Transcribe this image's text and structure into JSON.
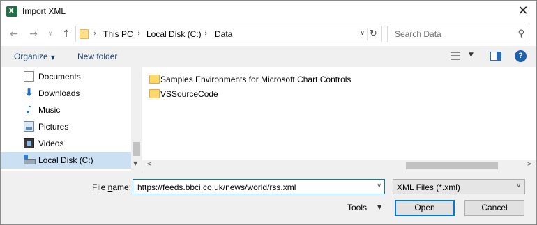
{
  "window": {
    "title": "Import XML",
    "close_glyph": "✕"
  },
  "address_bar": {
    "crumbs": [
      "This PC",
      "Local Disk (C:)",
      "Data"
    ],
    "separator": "›",
    "dropdown_glyph": "∨",
    "refresh_glyph": "↻"
  },
  "search": {
    "placeholder": "Search Data",
    "icon_glyph": "⚲"
  },
  "nav_buttons": {
    "back_glyph": "←",
    "forward_glyph": "→",
    "recent_glyph": "∨",
    "up_glyph": "↑"
  },
  "toolbar": {
    "organize_label": "Organize",
    "organize_caret": "▼",
    "new_folder_label": "New folder",
    "view_caret": "▼",
    "help_glyph": "?"
  },
  "nav_pane": {
    "items": [
      {
        "label": "Documents",
        "icon": "documents-icon",
        "selected": false
      },
      {
        "label": "Downloads",
        "icon": "downloads-icon",
        "selected": false
      },
      {
        "label": "Music",
        "icon": "music-icon",
        "selected": false
      },
      {
        "label": "Pictures",
        "icon": "pictures-icon",
        "selected": false
      },
      {
        "label": "Videos",
        "icon": "videos-icon",
        "selected": false
      },
      {
        "label": "Local Disk (C:)",
        "icon": "local-disk-icon",
        "selected": true
      }
    ],
    "download_glyph": "⬇",
    "music_glyph": "♪"
  },
  "files": [
    {
      "name": "Samples Environments for Microsoft Chart Controls",
      "icon": "folder-icon"
    },
    {
      "name": "VSSourceCode",
      "icon": "folder-icon"
    }
  ],
  "scroll": {
    "down_glyph": "▼",
    "left_glyph": "<",
    "right_glyph": ">"
  },
  "bottom": {
    "file_name_label_pre": "File ",
    "file_name_label_accel": "n",
    "file_name_label_post": "ame:",
    "file_name_value": "https://feeds.bbci.co.uk/news/world/rss.xml",
    "file_name_drop_glyph": "∨",
    "filter_value": "XML Files (*.xml)",
    "filter_drop_glyph": "∨",
    "tools_label": "Tools",
    "tools_caret": "▼",
    "open_label": "Open",
    "cancel_label": "Cancel"
  },
  "colors": {
    "selected_bg": "#cce0f4",
    "accent": "#0078d7",
    "link_text": "#1a3f66"
  }
}
